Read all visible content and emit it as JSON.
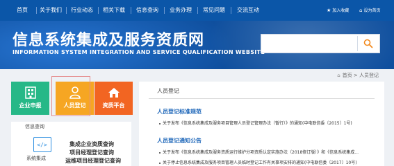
{
  "nav": {
    "items": [
      "首页",
      "关于我们",
      "行业动态",
      "相关下载",
      "信息查询",
      "业务办理",
      "常见问题",
      "交流互动"
    ],
    "favorite": "加入收藏",
    "homepage": "设为首页"
  },
  "header": {
    "title": "信息系统集成及服务资质网",
    "subtitle": "INFORMATION SYSTEM INTEGRATION AND SERVICE QUALIFICATION WEBSITE",
    "search_placeholder": ""
  },
  "breadcrumb": {
    "home": "首页",
    "separator": ">",
    "current": "人员登记"
  },
  "tiles": [
    {
      "label": "企业申报",
      "color": "#26b887",
      "icon": "building-icon"
    },
    {
      "label": "人员登记",
      "color": "#f6a623",
      "icon": "user-icon"
    },
    {
      "label": "资质平台",
      "color": "#f26522",
      "icon": "home-icon"
    }
  ],
  "info_panel": {
    "title": "信息查询",
    "icon_label": "系统集成",
    "links": [
      "集成企业资质查询",
      "项目经理登记查询",
      "运维项目经理登记查询"
    ]
  },
  "content": {
    "tab": "人员登记",
    "sections": [
      {
        "title": "人员登记标准规范",
        "articles": [
          "关于发布《信息系统集成及服务项目管理人员登记管理办法（暂行）》的通知(中电联信委〔2015〕1号)"
        ]
      },
      {
        "title": "人员登记通知公告",
        "articles": [
          "关于发布《信息系统集成及服务资质运行维护分项资质认定实施办法（2018修订版）》和《信息系统集成...",
          "关于停止信息系统集成及服务项目管理人员临时登记工作有关事项安排的通知(中电联信委〔2017〕10号)"
        ]
      }
    ]
  },
  "colors": {
    "nav_bg": "#0b56a8",
    "banner_bg": "#0f4f9e",
    "accent_link": "#1a64b8"
  }
}
